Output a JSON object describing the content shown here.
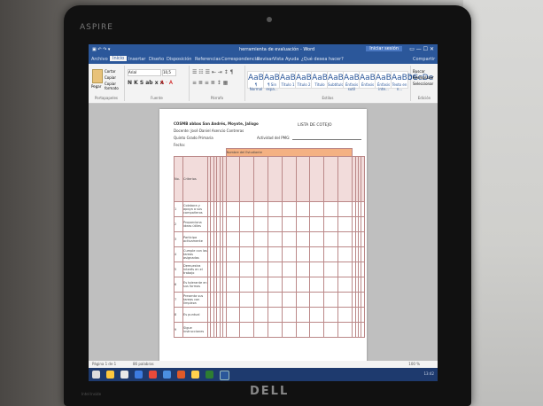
{
  "laptop": {
    "brand": "ASPIRE",
    "maker": "DELL",
    "sticker": "Intel Inside"
  },
  "titlebar": {
    "quick_access": "▣ ↶ ↷ ▾",
    "title": "herramienta de evaluación - Word",
    "login": "Iniciar sesión",
    "controls": "▭  —  ☐  ✕"
  },
  "menubar": {
    "items": [
      "Archivo",
      "Inicio",
      "Insertar",
      "Diseño",
      "Disposición",
      "Referencias",
      "Correspondencia",
      "Revisar",
      "Vista",
      "Ayuda",
      "¿Qué desea hacer?"
    ],
    "share": "Compartir"
  },
  "ribbon": {
    "clipboard_label": "Portapapeles",
    "paste": "Pegar",
    "cut": "Cortar",
    "copy": "Copiar",
    "format_painter": "Copiar formato",
    "font_label": "Fuente",
    "font_name": "Arial",
    "font_size": "10,5",
    "paragraph_label": "Párrafo",
    "styles_label": "Estilos",
    "editing_label": "Edición",
    "find": "Buscar",
    "replace": "Reemplazar",
    "select": "Seleccionar",
    "styles": [
      {
        "sample": "AaBbCcDc",
        "name": "¶ Normal"
      },
      {
        "sample": "AaBbCcDc",
        "name": "¶ Sin espa..."
      },
      {
        "sample": "AaBbC",
        "name": "Título 1"
      },
      {
        "sample": "AaBbCc",
        "name": "Título 2"
      },
      {
        "sample": "AaB",
        "name": "Título"
      },
      {
        "sample": "AaBbCcE",
        "name": "Subtítulo"
      },
      {
        "sample": "AaBbCcDe",
        "name": "Énfasis sutil"
      },
      {
        "sample": "AaBbCcDe",
        "name": "Énfasis"
      },
      {
        "sample": "AaBbCcDe",
        "name": "Énfasis inte..."
      },
      {
        "sample": "AaBbCcDe",
        "name": "Texto en n..."
      }
    ]
  },
  "document": {
    "school": "COSMB abbas San Andrés, Moyote, Jalisgo",
    "teacher": "Docente: José Daniel Asencio Contreras",
    "grade": "Quinto Grado Primaria",
    "date": "Fecha:",
    "list_title": "LISTA DE COTEJO",
    "activity": "Actividad del PMG:",
    "student_header": "Nombre del Estudiante",
    "no_header": "No.",
    "criteria_header": "Criterios",
    "criteria": [
      {
        "n": "1",
        "text": "Colabora y apoya a sus compañeros"
      },
      {
        "n": "2",
        "text": "Proporciona ideas útiles"
      },
      {
        "n": "3",
        "text": "Participa activamente"
      },
      {
        "n": "4",
        "text": "Cumple con las tareas asignadas"
      },
      {
        "n": "5",
        "text": "Demuestra interés en el trabajo"
      },
      {
        "n": "6",
        "text": "Es tolerante en sus formas"
      },
      {
        "n": "7",
        "text": "Presenta sus tareas con limpieza"
      },
      {
        "n": "8",
        "text": "Es puntual"
      },
      {
        "n": "9",
        "text": "Sigue instrucciones"
      }
    ]
  },
  "statusbar": {
    "page": "Página 1 de 1",
    "words": "86 palabras",
    "zoom": "100 %"
  },
  "taskbar": {
    "clock": "13:42"
  },
  "colors": {
    "word_blue": "#2b579a",
    "orange_header": "#f4b183",
    "pink_header": "#f2dcdb"
  }
}
